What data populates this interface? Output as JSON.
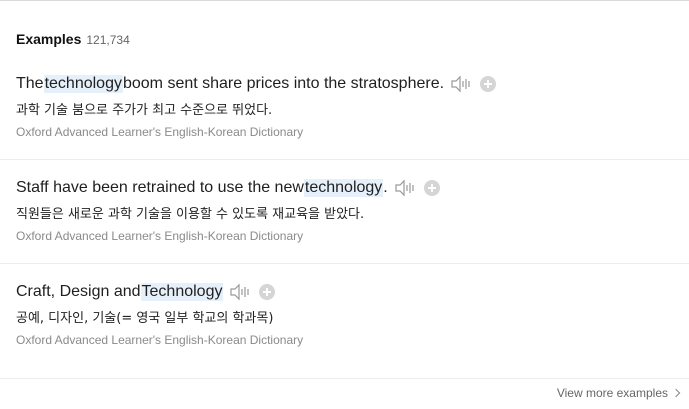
{
  "header": {
    "title": "Examples",
    "count": "121,734"
  },
  "examples": [
    {
      "en": {
        "before": "The ",
        "highlight": "technology",
        "after": " boom sent share prices into the stratosphere."
      },
      "ko": "과학 기술 붐으로 주가가 최고 수준으로 뛰었다.",
      "source": "Oxford Advanced Learner's English-Korean Dictionary"
    },
    {
      "en": {
        "before": "Staff have been retrained to use the new ",
        "highlight": "technology",
        "after": "."
      },
      "ko": "직원들은 새로운 과학 기술을 이용할 수 있도록 재교육을 받았다.",
      "source": "Oxford Advanced Learner's English-Korean Dictionary"
    },
    {
      "en": {
        "before": "Craft, Design and ",
        "highlight": "Technology",
        "after": ""
      },
      "ko": "공예, 디자인, 기술(= 영국 일부 학교의 학과목)",
      "source": "Oxford Advanced Learner's English-Korean Dictionary"
    }
  ],
  "footer": {
    "view_more": "View more examples"
  },
  "icons": {
    "speaker": "speaker-icon",
    "add": "plus-circle-icon",
    "chevron": "chevron-right-icon"
  },
  "colors": {
    "highlight_bg": "#e6f0fb",
    "source_text": "#8a8a8a",
    "icon_gray": "#9a9a9a"
  }
}
